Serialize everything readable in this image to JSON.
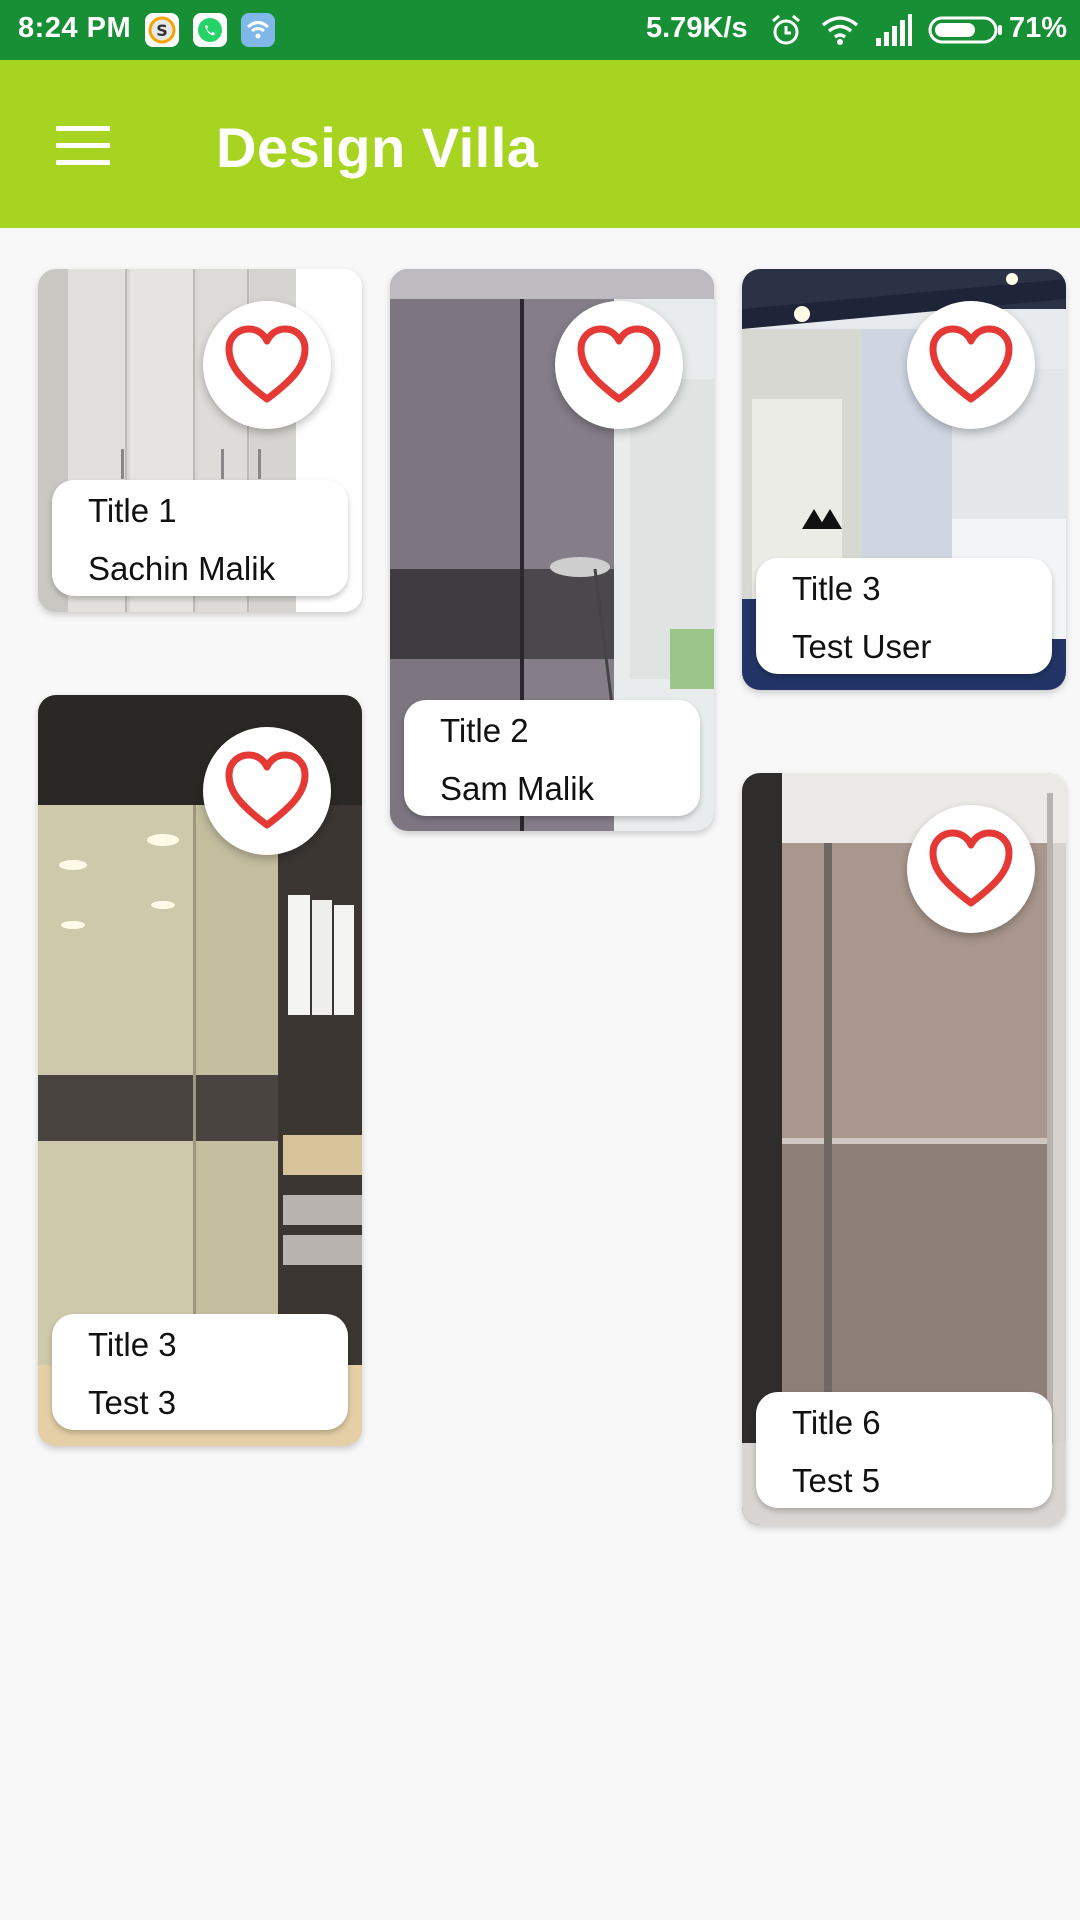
{
  "status_bar": {
    "time": "8:24 PM",
    "net_speed": "5.79K/s",
    "battery_percent": "71%",
    "battery_level": 0.71,
    "icons": [
      "sketch-app-icon",
      "whatsapp-icon",
      "wifi-app-icon",
      "alarm-icon",
      "wifi-icon",
      "signal-icon",
      "battery-icon"
    ]
  },
  "app_bar": {
    "title": "Design Villa",
    "menu_icon": "hamburger-menu-icon",
    "color": "#a6d420"
  },
  "colors": {
    "status_bar": "#178f34",
    "heart": "#e53935",
    "background": "#f8f8f8"
  },
  "cards": [
    {
      "title": "Title 1",
      "author": "Sachin Malik",
      "icon": "heart-outline-icon"
    },
    {
      "title": "Title 2",
      "author": "Sam Malik",
      "icon": "heart-outline-icon"
    },
    {
      "title": "Title 3",
      "author": "Test User",
      "icon": "heart-outline-icon"
    },
    {
      "title": "Title 3",
      "author": "Test 3",
      "icon": "heart-outline-icon"
    },
    {
      "title": "Title 6",
      "author": "Test 5",
      "icon": "heart-outline-icon"
    }
  ]
}
